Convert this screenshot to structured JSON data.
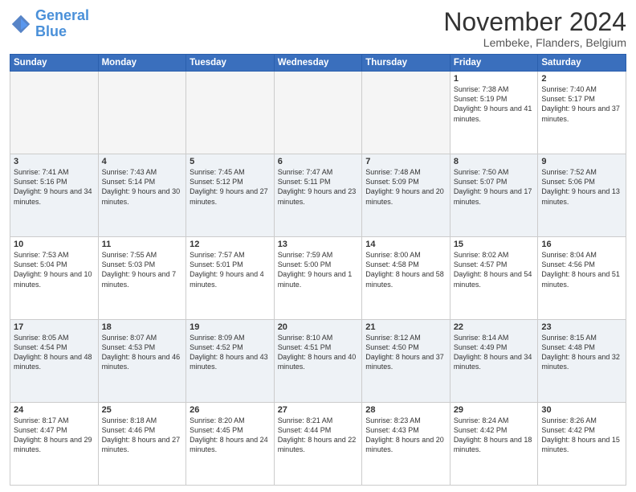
{
  "logo": {
    "line1": "General",
    "line2": "Blue"
  },
  "title": "November 2024",
  "location": "Lembeke, Flanders, Belgium",
  "headers": [
    "Sunday",
    "Monday",
    "Tuesday",
    "Wednesday",
    "Thursday",
    "Friday",
    "Saturday"
  ],
  "weeks": [
    [
      {
        "day": "",
        "info": ""
      },
      {
        "day": "",
        "info": ""
      },
      {
        "day": "",
        "info": ""
      },
      {
        "day": "",
        "info": ""
      },
      {
        "day": "",
        "info": ""
      },
      {
        "day": "1",
        "info": "Sunrise: 7:38 AM\nSunset: 5:19 PM\nDaylight: 9 hours and 41 minutes."
      },
      {
        "day": "2",
        "info": "Sunrise: 7:40 AM\nSunset: 5:17 PM\nDaylight: 9 hours and 37 minutes."
      }
    ],
    [
      {
        "day": "3",
        "info": "Sunrise: 7:41 AM\nSunset: 5:16 PM\nDaylight: 9 hours and 34 minutes."
      },
      {
        "day": "4",
        "info": "Sunrise: 7:43 AM\nSunset: 5:14 PM\nDaylight: 9 hours and 30 minutes."
      },
      {
        "day": "5",
        "info": "Sunrise: 7:45 AM\nSunset: 5:12 PM\nDaylight: 9 hours and 27 minutes."
      },
      {
        "day": "6",
        "info": "Sunrise: 7:47 AM\nSunset: 5:11 PM\nDaylight: 9 hours and 23 minutes."
      },
      {
        "day": "7",
        "info": "Sunrise: 7:48 AM\nSunset: 5:09 PM\nDaylight: 9 hours and 20 minutes."
      },
      {
        "day": "8",
        "info": "Sunrise: 7:50 AM\nSunset: 5:07 PM\nDaylight: 9 hours and 17 minutes."
      },
      {
        "day": "9",
        "info": "Sunrise: 7:52 AM\nSunset: 5:06 PM\nDaylight: 9 hours and 13 minutes."
      }
    ],
    [
      {
        "day": "10",
        "info": "Sunrise: 7:53 AM\nSunset: 5:04 PM\nDaylight: 9 hours and 10 minutes."
      },
      {
        "day": "11",
        "info": "Sunrise: 7:55 AM\nSunset: 5:03 PM\nDaylight: 9 hours and 7 minutes."
      },
      {
        "day": "12",
        "info": "Sunrise: 7:57 AM\nSunset: 5:01 PM\nDaylight: 9 hours and 4 minutes."
      },
      {
        "day": "13",
        "info": "Sunrise: 7:59 AM\nSunset: 5:00 PM\nDaylight: 9 hours and 1 minute."
      },
      {
        "day": "14",
        "info": "Sunrise: 8:00 AM\nSunset: 4:58 PM\nDaylight: 8 hours and 58 minutes."
      },
      {
        "day": "15",
        "info": "Sunrise: 8:02 AM\nSunset: 4:57 PM\nDaylight: 8 hours and 54 minutes."
      },
      {
        "day": "16",
        "info": "Sunrise: 8:04 AM\nSunset: 4:56 PM\nDaylight: 8 hours and 51 minutes."
      }
    ],
    [
      {
        "day": "17",
        "info": "Sunrise: 8:05 AM\nSunset: 4:54 PM\nDaylight: 8 hours and 48 minutes."
      },
      {
        "day": "18",
        "info": "Sunrise: 8:07 AM\nSunset: 4:53 PM\nDaylight: 8 hours and 46 minutes."
      },
      {
        "day": "19",
        "info": "Sunrise: 8:09 AM\nSunset: 4:52 PM\nDaylight: 8 hours and 43 minutes."
      },
      {
        "day": "20",
        "info": "Sunrise: 8:10 AM\nSunset: 4:51 PM\nDaylight: 8 hours and 40 minutes."
      },
      {
        "day": "21",
        "info": "Sunrise: 8:12 AM\nSunset: 4:50 PM\nDaylight: 8 hours and 37 minutes."
      },
      {
        "day": "22",
        "info": "Sunrise: 8:14 AM\nSunset: 4:49 PM\nDaylight: 8 hours and 34 minutes."
      },
      {
        "day": "23",
        "info": "Sunrise: 8:15 AM\nSunset: 4:48 PM\nDaylight: 8 hours and 32 minutes."
      }
    ],
    [
      {
        "day": "24",
        "info": "Sunrise: 8:17 AM\nSunset: 4:47 PM\nDaylight: 8 hours and 29 minutes."
      },
      {
        "day": "25",
        "info": "Sunrise: 8:18 AM\nSunset: 4:46 PM\nDaylight: 8 hours and 27 minutes."
      },
      {
        "day": "26",
        "info": "Sunrise: 8:20 AM\nSunset: 4:45 PM\nDaylight: 8 hours and 24 minutes."
      },
      {
        "day": "27",
        "info": "Sunrise: 8:21 AM\nSunset: 4:44 PM\nDaylight: 8 hours and 22 minutes."
      },
      {
        "day": "28",
        "info": "Sunrise: 8:23 AM\nSunset: 4:43 PM\nDaylight: 8 hours and 20 minutes."
      },
      {
        "day": "29",
        "info": "Sunrise: 8:24 AM\nSunset: 4:42 PM\nDaylight: 8 hours and 18 minutes."
      },
      {
        "day": "30",
        "info": "Sunrise: 8:26 AM\nSunset: 4:42 PM\nDaylight: 8 hours and 15 minutes."
      }
    ]
  ]
}
